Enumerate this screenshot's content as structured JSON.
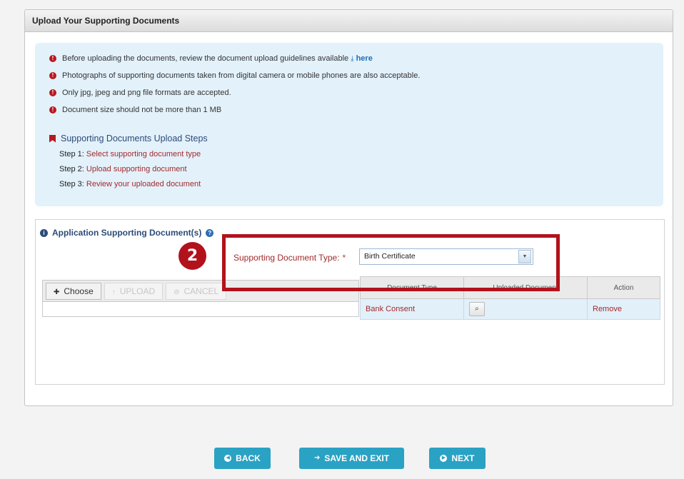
{
  "panel": {
    "title": "Upload Your Supporting Documents"
  },
  "guidelines": {
    "lines": [
      "Before uploading the documents, review the document upload guidelines available",
      "Photographs of supporting documents taken from digital camera or mobile phones are also acceptable.",
      "Only jpg, jpeg and png file formats are accepted.",
      "Document size should not be more than 1 MB"
    ],
    "here_link": "here",
    "steps_title": "Supporting Documents Upload Steps",
    "steps": [
      {
        "key": "Step 1:",
        "value": "Select supporting document type"
      },
      {
        "key": "Step 2:",
        "value": "Upload supporting document"
      },
      {
        "key": "Step 3:",
        "value": "Review your uploaded document"
      }
    ]
  },
  "section": {
    "title": "Application Supporting Document(s)",
    "type_label": "Supporting Document Type:",
    "required_mark": "*",
    "type_value": "Birth Certificate"
  },
  "uploader": {
    "choose": "Choose",
    "upload": "UPLOAD",
    "cancel": "CANCEL"
  },
  "table": {
    "headers": [
      "Document Type",
      "Uploaded Document",
      "Action"
    ],
    "rows": [
      {
        "type": "Bank Consent",
        "action": "Remove"
      }
    ]
  },
  "annotation": {
    "step_number": "2"
  },
  "nav": {
    "back": "BACK",
    "save_exit": "SAVE AND EXIT",
    "next": "NEXT"
  },
  "colors": {
    "accent": "#2aa2c4",
    "annotation": "#b2121c",
    "info_bg": "#e3f1fb"
  }
}
